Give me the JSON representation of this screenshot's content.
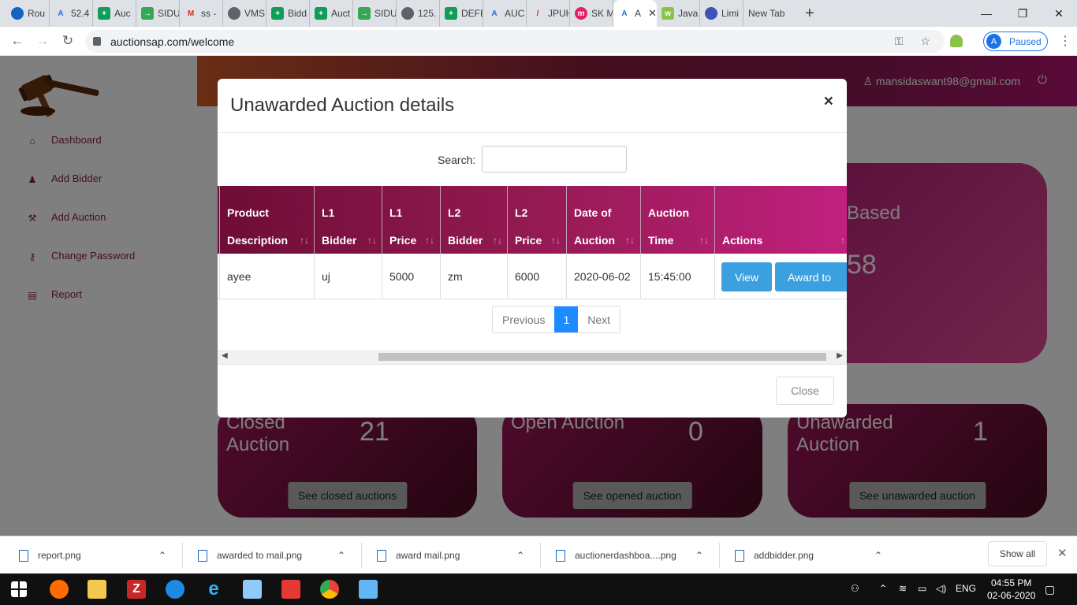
{
  "browser": {
    "tabs": [
      "Rou",
      "52.4",
      "Auc",
      "SIDU",
      "ss -",
      "VMS",
      "Bidd",
      "Auct",
      "SIDU",
      "125.",
      "DEFE",
      "AUC",
      "JPUH",
      "SK M",
      "A",
      "Java",
      "Limi",
      "New Tab"
    ],
    "url": "auctionsap.com/welcome",
    "profile_initial": "A",
    "profile_status": "Paused"
  },
  "sidebar": {
    "items": [
      {
        "label": "Dashboard",
        "icon": "home-icon"
      },
      {
        "label": "Add Bidder",
        "icon": "add-user-icon"
      },
      {
        "label": "Add Auction",
        "icon": "gavel-icon"
      },
      {
        "label": "Change Password",
        "icon": "key-icon"
      },
      {
        "label": "Report",
        "icon": "book-icon"
      }
    ]
  },
  "header": {
    "user": "mansidaswant98@gmail.com"
  },
  "cards": {
    "closed": {
      "title1": "Closed",
      "title2": "Auction",
      "count": "21",
      "button": "See closed auctions"
    },
    "open": {
      "title1": "Open Auction",
      "title2": "",
      "count": "0",
      "button": "See opened auction"
    },
    "unawarded": {
      "title1": "Unawarded",
      "title2": "Auction",
      "count": "1",
      "button": "See unawarded auction"
    },
    "partial": {
      "title": "Based",
      "count": "58"
    }
  },
  "modal": {
    "title": "Unawarded Auction details",
    "close_x": "×",
    "search_label": "Search:",
    "columns": [
      {
        "l1": "Product",
        "l2": "Description"
      },
      {
        "l1": "L1",
        "l2": "Bidder"
      },
      {
        "l1": "L1",
        "l2": "Price"
      },
      {
        "l1": "L2",
        "l2": "Bidder"
      },
      {
        "l1": "L2",
        "l2": "Price"
      },
      {
        "l1": "Date of",
        "l2": "Auction"
      },
      {
        "l1": "Auction",
        "l2": "Time"
      },
      {
        "l1": "",
        "l2": "Actions"
      }
    ],
    "rows": [
      {
        "product": "ayee",
        "l1_bidder": "uj",
        "l1_price": "5000",
        "l2_bidder": "zm",
        "l2_price": "6000",
        "date": "2020-06-02",
        "time": "15:45:00"
      }
    ],
    "view_button": "View",
    "award_button": "Award to",
    "pager": {
      "prev": "Previous",
      "page": "1",
      "next": "Next"
    },
    "close_button": "Close"
  },
  "downloads": {
    "files": [
      "report.png",
      "awarded to mail.png",
      "award mail.png",
      "auctionerdashboa....png",
      "addbidder.png"
    ],
    "show_all": "Show all"
  },
  "taskbar": {
    "lang": "ENG",
    "time": "04:55 PM",
    "date": "02-06-2020"
  }
}
